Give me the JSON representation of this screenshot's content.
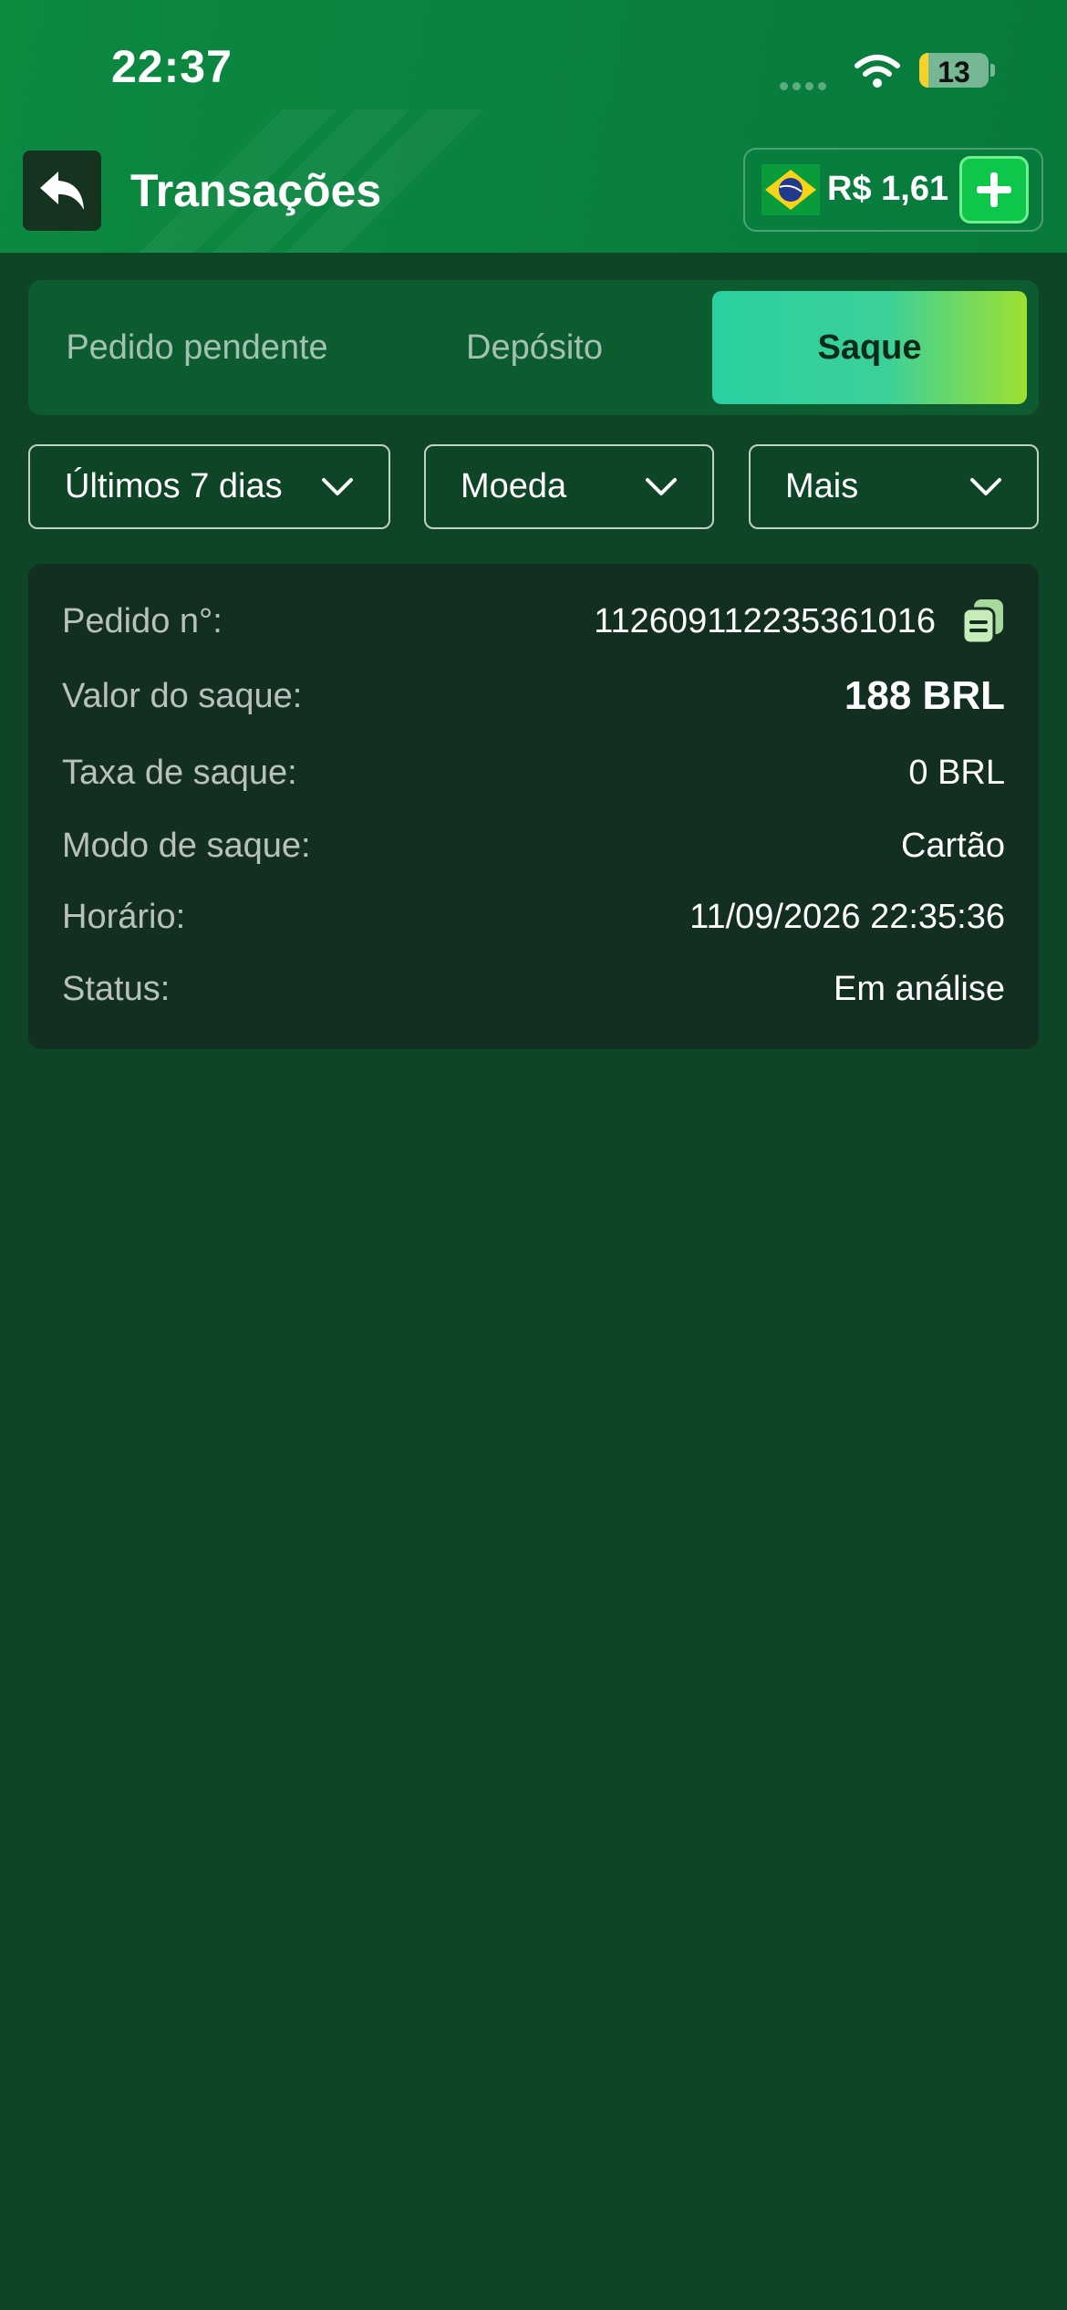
{
  "status_bar": {
    "time": "22:37",
    "battery": "13"
  },
  "header": {
    "title": "Transações",
    "balance": "R$ 1,61"
  },
  "tabs": [
    {
      "label": "Pedido pendente",
      "active": false
    },
    {
      "label": "Depósito",
      "active": false
    },
    {
      "label": "Saque",
      "active": true
    }
  ],
  "filters": {
    "period": "Últimos 7 dias",
    "currency": "Moeda",
    "more": "Mais"
  },
  "transaction": {
    "order_label": "Pedido n°:",
    "order_value": "112609112235361016",
    "amount_label": "Valor do saque:",
    "amount_value": "188 BRL",
    "fee_label": "Taxa de saque:",
    "fee_value": "0 BRL",
    "mode_label": "Modo de saque:",
    "mode_value": "Cartão",
    "time_label": "Horário:",
    "time_value": "11/09/2026 22:35:36",
    "status_label": "Status:",
    "status_value": "Em análise"
  },
  "colors": {
    "background": "#0f4527",
    "header": "#0a8340",
    "active_tab_start": "#2ad0a0",
    "active_tab_end": "#9ee032",
    "card": "#132f21"
  }
}
